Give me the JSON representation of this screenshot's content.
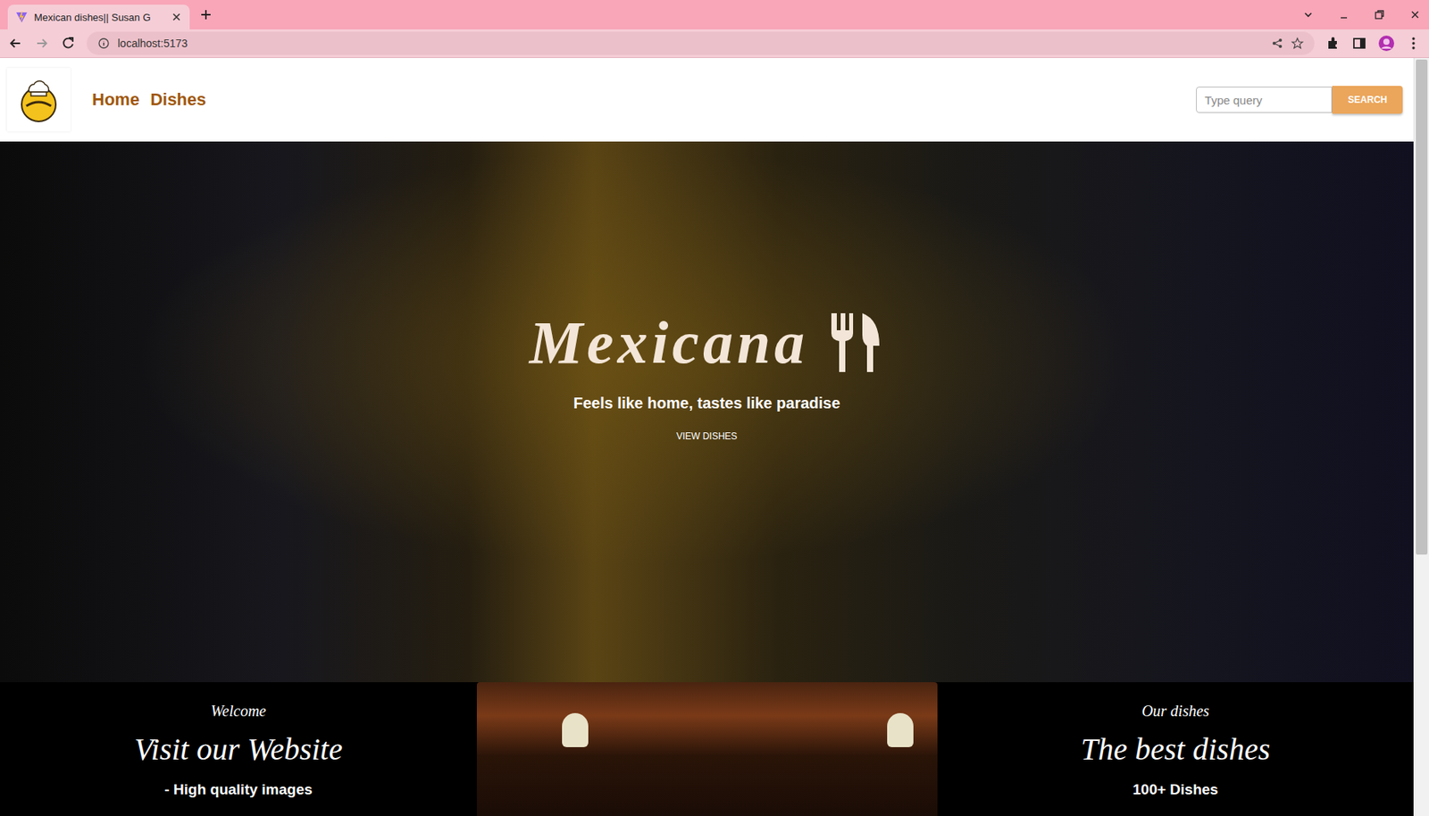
{
  "browser": {
    "tabs": [
      {
        "title": "Mexican dishes|| Susan G",
        "selected": true
      }
    ],
    "url": "localhost:5173"
  },
  "header": {
    "nav": [
      {
        "label": "Home"
      },
      {
        "label": "Dishes"
      }
    ],
    "search": {
      "placeholder": "Type query",
      "button": "SEARCH"
    }
  },
  "hero": {
    "title": "Mexicana",
    "tagline": "Feels like home, tastes like paradise",
    "button": "VIEW DISHES"
  },
  "features": [
    {
      "kicker": "Welcome",
      "heading": "Visit our Website",
      "item": "- High quality images"
    },
    {
      "kicker": "Our dishes",
      "heading": "The best dishes",
      "item": "100+ Dishes"
    }
  ]
}
